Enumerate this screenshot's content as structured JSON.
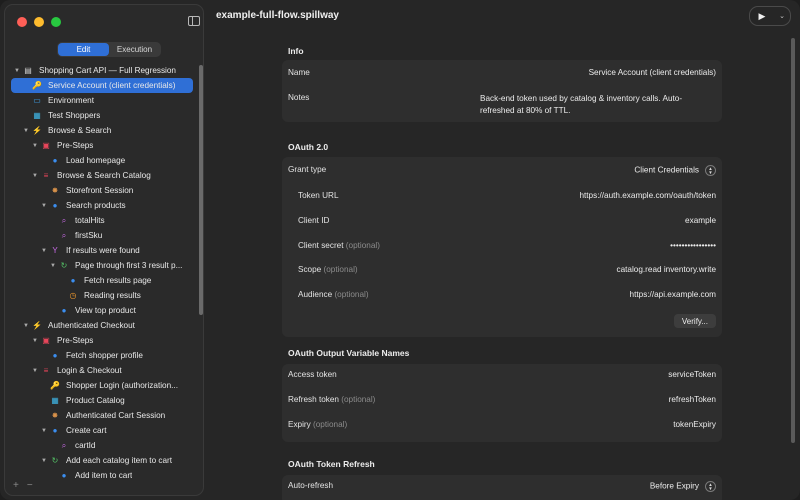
{
  "window": {
    "title": "example-full-flow.spillway"
  },
  "sidebar": {
    "modes": [
      "Edit",
      "Execution"
    ],
    "active_mode": "Edit",
    "tree": [
      {
        "label": "Shopping Cart API — Full Regression",
        "icon": "document-icon",
        "depth": 0,
        "chev": "down"
      },
      {
        "label": "Service Account (client credentials)",
        "icon": "key-icon",
        "depth": 1,
        "selected": true
      },
      {
        "label": "Environment",
        "icon": "panel-icon",
        "depth": 1
      },
      {
        "label": "Test Shoppers",
        "icon": "table-icon",
        "depth": 1
      },
      {
        "label": "Browse & Search",
        "icon": "bolt-icon",
        "depth": 1,
        "chev": "down"
      },
      {
        "label": "Pre-Steps",
        "icon": "presteps-icon",
        "depth": 2,
        "chev": "down"
      },
      {
        "label": "Load homepage",
        "icon": "globe-icon",
        "depth": 3
      },
      {
        "label": "Browse & Search Catalog",
        "icon": "list-icon",
        "depth": 2,
        "chev": "down"
      },
      {
        "label": "Storefront Session",
        "icon": "cookie-icon",
        "depth": 3
      },
      {
        "label": "Search products",
        "icon": "globe-icon",
        "depth": 3,
        "chev": "down"
      },
      {
        "label": "totalHits",
        "icon": "extract-icon",
        "depth": 4
      },
      {
        "label": "firstSku",
        "icon": "extract-icon",
        "depth": 4
      },
      {
        "label": "If results were found",
        "icon": "branch-icon",
        "depth": 3,
        "chev": "down"
      },
      {
        "label": "Page through first 3 result p...",
        "icon": "loop-icon",
        "depth": 4,
        "chev": "down"
      },
      {
        "label": "Fetch results page",
        "icon": "globe-icon",
        "depth": 5
      },
      {
        "label": "Reading results",
        "icon": "timer-icon",
        "depth": 5
      },
      {
        "label": "View top product",
        "icon": "globe-icon",
        "depth": 4
      },
      {
        "label": "Authenticated Checkout",
        "icon": "bolt-icon",
        "depth": 1,
        "chev": "down"
      },
      {
        "label": "Pre-Steps",
        "icon": "presteps-icon",
        "depth": 2,
        "chev": "down"
      },
      {
        "label": "Fetch shopper profile",
        "icon": "globe-icon",
        "depth": 3
      },
      {
        "label": "Login & Checkout",
        "icon": "list-icon",
        "depth": 2,
        "chev": "down"
      },
      {
        "label": "Shopper Login (authorization...",
        "icon": "key-icon",
        "depth": 3
      },
      {
        "label": "Product Catalog",
        "icon": "table-icon",
        "depth": 3
      },
      {
        "label": "Authenticated Cart Session",
        "icon": "cookie-icon",
        "depth": 3
      },
      {
        "label": "Create cart",
        "icon": "globe-icon",
        "depth": 3,
        "chev": "down"
      },
      {
        "label": "cartId",
        "icon": "extract-icon",
        "depth": 4
      },
      {
        "label": "Add each catalog item to cart",
        "icon": "loop-icon",
        "depth": 3,
        "chev": "down"
      },
      {
        "label": "Add item to cart",
        "icon": "globe-icon",
        "depth": 4
      }
    ],
    "footer": {
      "add": "+",
      "remove": "−"
    }
  },
  "main": {
    "info": {
      "title": "Info",
      "name_label": "Name",
      "name_value": "Service Account (client credentials)",
      "notes_label": "Notes",
      "notes_value_1": "Back-end token used by catalog & inventory calls. Auto-",
      "notes_value_2": "refreshed at 80% of TTL."
    },
    "oauth": {
      "title": "OAuth 2.0",
      "grant_label": "Grant type",
      "grant_value": "Client Credentials",
      "token_url_label": "Token URL",
      "token_url_value": "https://auth.example.com/oauth/token",
      "client_id_label": "Client ID",
      "client_id_value": "example",
      "client_secret_label": "Client secret",
      "client_secret_opt": "(optional)",
      "client_secret_value": "••••••••••••••••",
      "scope_label": "Scope",
      "scope_opt": "(optional)",
      "scope_value": "catalog.read inventory.write",
      "audience_label": "Audience",
      "audience_opt": "(optional)",
      "audience_value": "https://api.example.com",
      "verify_label": "Verify..."
    },
    "output": {
      "title": "OAuth Output Variable Names",
      "access_label": "Access token",
      "access_value": "serviceToken",
      "refresh_label": "Refresh token",
      "refresh_opt": "(optional)",
      "refresh_value": "refreshToken",
      "expiry_label": "Expiry",
      "expiry_opt": "(optional)",
      "expiry_value": "tokenExpiry"
    },
    "refresh": {
      "title": "OAuth Token Refresh",
      "auto_label": "Auto-refresh",
      "auto_value": "Before Expiry"
    }
  }
}
